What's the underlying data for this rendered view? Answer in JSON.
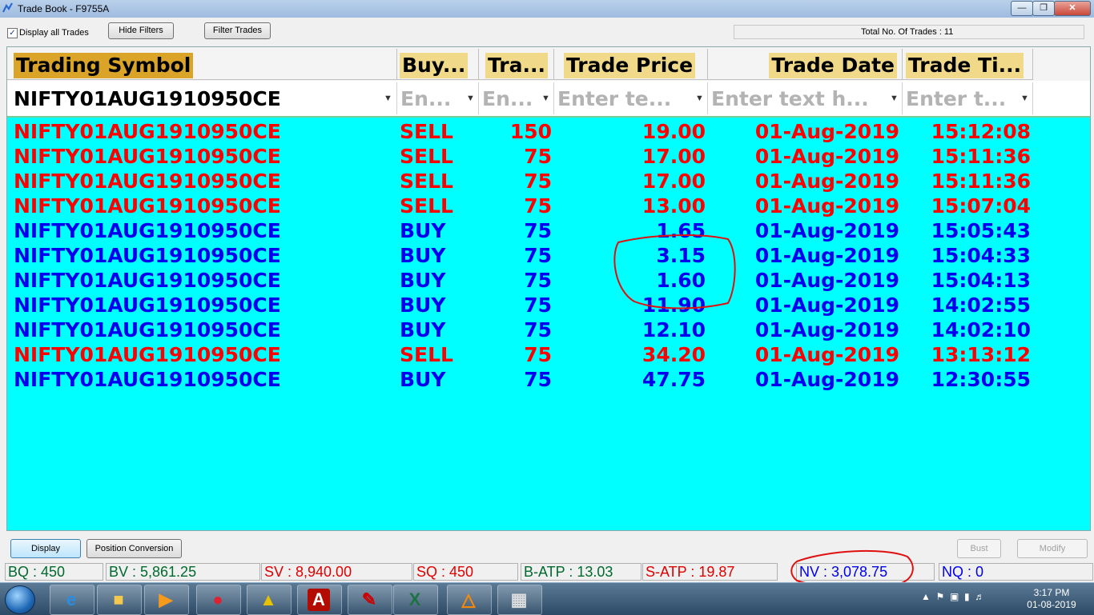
{
  "window": {
    "title": "Trade Book - F9755A"
  },
  "toolbar": {
    "display_all_label": "Display all Trades",
    "display_all_checked": true,
    "hide_filters": "Hide Filters",
    "filter_trades": "Filter Trades",
    "total_trades": "Total No. Of Trades : 11"
  },
  "grid": {
    "columns": [
      "Trading Symbol",
      "Buy...",
      "Tra...",
      "Trade Price",
      "Trade Date",
      "Trade Ti..."
    ],
    "filters": [
      "NIFTY01AUG1910950CE",
      "En...",
      "En...",
      "Enter te...",
      "Enter text h...",
      "Enter t..."
    ],
    "rows": [
      {
        "symbol": "NIFTY01AUG1910950CE",
        "side": "SELL",
        "qty": "150",
        "price": "19.00",
        "date": "01-Aug-2019",
        "time": "15:12:08"
      },
      {
        "symbol": "NIFTY01AUG1910950CE",
        "side": "SELL",
        "qty": "75",
        "price": "17.00",
        "date": "01-Aug-2019",
        "time": "15:11:36"
      },
      {
        "symbol": "NIFTY01AUG1910950CE",
        "side": "SELL",
        "qty": "75",
        "price": "17.00",
        "date": "01-Aug-2019",
        "time": "15:11:36"
      },
      {
        "symbol": "NIFTY01AUG1910950CE",
        "side": "SELL",
        "qty": "75",
        "price": "13.00",
        "date": "01-Aug-2019",
        "time": "15:07:04"
      },
      {
        "symbol": "NIFTY01AUG1910950CE",
        "side": "BUY",
        "qty": "75",
        "price": "1.65",
        "date": "01-Aug-2019",
        "time": "15:05:43"
      },
      {
        "symbol": "NIFTY01AUG1910950CE",
        "side": "BUY",
        "qty": "75",
        "price": "3.15",
        "date": "01-Aug-2019",
        "time": "15:04:33"
      },
      {
        "symbol": "NIFTY01AUG1910950CE",
        "side": "BUY",
        "qty": "75",
        "price": "1.60",
        "date": "01-Aug-2019",
        "time": "15:04:13"
      },
      {
        "symbol": "NIFTY01AUG1910950CE",
        "side": "BUY",
        "qty": "75",
        "price": "11.90",
        "date": "01-Aug-2019",
        "time": "14:02:55"
      },
      {
        "symbol": "NIFTY01AUG1910950CE",
        "side": "BUY",
        "qty": "75",
        "price": "12.10",
        "date": "01-Aug-2019",
        "time": "14:02:10"
      },
      {
        "symbol": "NIFTY01AUG1910950CE",
        "side": "SELL",
        "qty": "75",
        "price": "34.20",
        "date": "01-Aug-2019",
        "time": "13:13:12"
      },
      {
        "symbol": "NIFTY01AUG1910950CE",
        "side": "BUY",
        "qty": "75",
        "price": "47.75",
        "date": "01-Aug-2019",
        "time": "12:30:55"
      }
    ]
  },
  "bottom": {
    "display": "Display",
    "position_conversion": "Position Conversion",
    "bust": "Bust",
    "modify": "Modify"
  },
  "status": {
    "bq": "BQ : 450",
    "bv": "BV : 5,861.25",
    "sv": "SV : 8,940.00",
    "sq": "SQ : 450",
    "b_atp": "B-ATP : 13.03",
    "s_atp": "S-ATP : 19.87",
    "nv": "NV : 3,078.75",
    "nq": "NQ : 0"
  },
  "taskbar": {
    "clock_time": "3:17 PM",
    "clock_date": "01-08-2019",
    "apps": [
      "internet-explorer",
      "file-explorer",
      "media-player",
      "chrome",
      "trading-terminal",
      "acrobat-reader",
      "pdf-editor",
      "excel",
      "amibroker",
      "calculator"
    ]
  },
  "colors": {
    "grid_bg": "#00ffff",
    "sell": "#ff0000",
    "buy": "#0000ee",
    "annotation": "#e01010"
  }
}
